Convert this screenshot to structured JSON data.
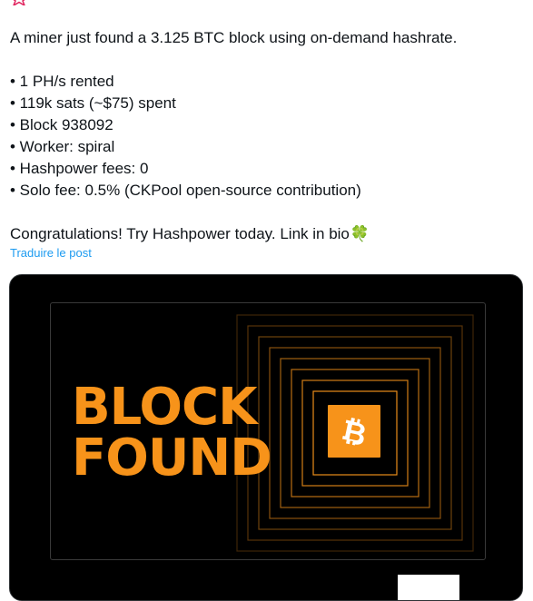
{
  "post": {
    "lines": [
      "A miner just found a 3.125 BTC block using on-demand hashrate.",
      "",
      "• 1 PH/s rented",
      "• 119k sats (~$75) spent",
      "• Block 938092",
      "• Worker: spiral",
      "• Hashpower fees: 0",
      "• Solo fee: 0.5% (CKPool open-source contribution)",
      "",
      "Congratulations! Try Hashpower today. Link in bio"
    ],
    "emoji": "🍀",
    "translate_label": "Traduire le post"
  },
  "media": {
    "headline_line1": "BLOCK",
    "headline_line2": "FOUND",
    "accent_color": "#f7931a",
    "icon": "bitcoin-icon"
  }
}
